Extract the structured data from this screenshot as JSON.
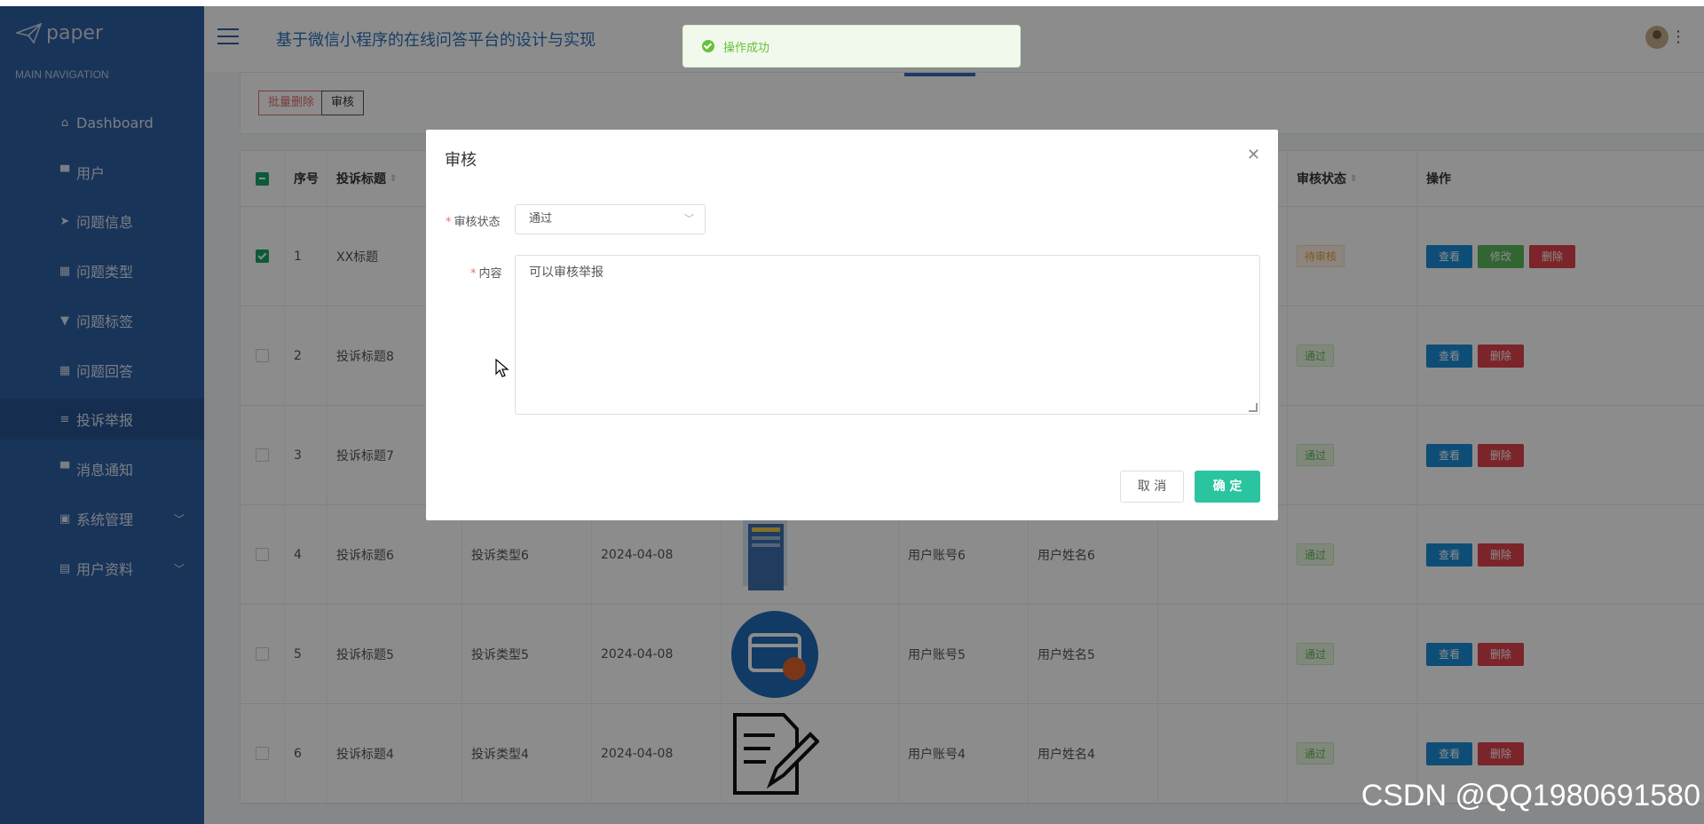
{
  "app": {
    "logo_text": "paper",
    "system_title": "基于微信小程序的在线问答平台的设计与实现"
  },
  "sidebar": {
    "heading": "MAIN NAVIGATION",
    "items": [
      {
        "label": "Dashboard",
        "icon": "home-icon"
      },
      {
        "label": "用户",
        "icon": "comment-icon"
      },
      {
        "label": "问题信息",
        "icon": "send-icon"
      },
      {
        "label": "问题类型",
        "icon": "grid-icon"
      },
      {
        "label": "问题标签",
        "icon": "tag-icon"
      },
      {
        "label": "问题回答",
        "icon": "grid-icon"
      },
      {
        "label": "投诉举报",
        "icon": "list-icon",
        "active": true
      },
      {
        "label": "消息通知",
        "icon": "comment-icon"
      },
      {
        "label": "系统管理",
        "icon": "lock-icon",
        "expandable": true
      },
      {
        "label": "用户资料",
        "icon": "calendar-icon",
        "expandable": true
      }
    ]
  },
  "toolbar": {
    "batch_delete_label": "批量删除",
    "audit_label": "审核"
  },
  "table": {
    "columns": [
      "序号",
      "投诉标题",
      "审核状态",
      "操作"
    ],
    "rows": [
      {
        "index": "1",
        "title": "XX标题",
        "type": "",
        "date": "",
        "account": "",
        "name": "",
        "status": "待审核",
        "checked": true,
        "actions": [
          "查看",
          "修改",
          "删除"
        ]
      },
      {
        "index": "2",
        "title": "投诉标题8",
        "type": "",
        "date": "",
        "account": "",
        "name": "",
        "status": "通过",
        "checked": false,
        "actions": [
          "查看",
          "删除"
        ]
      },
      {
        "index": "3",
        "title": "投诉标题7",
        "type": "",
        "date": "",
        "account": "",
        "name": "",
        "status": "通过",
        "checked": false,
        "actions": [
          "查看",
          "删除"
        ]
      },
      {
        "index": "4",
        "title": "投诉标题6",
        "type": "投诉类型6",
        "date": "2024-04-08",
        "account": "用户账号6",
        "name": "用户姓名6",
        "status": "通过",
        "checked": false,
        "actions": [
          "查看",
          "删除"
        ]
      },
      {
        "index": "5",
        "title": "投诉标题5",
        "type": "投诉类型5",
        "date": "2024-04-08",
        "account": "用户账号5",
        "name": "用户姓名5",
        "status": "通过",
        "checked": false,
        "actions": [
          "查看",
          "删除"
        ]
      },
      {
        "index": "6",
        "title": "投诉标题4",
        "type": "投诉类型4",
        "date": "2024-04-08",
        "account": "用户账号4",
        "name": "用户姓名4",
        "status": "通过",
        "checked": false,
        "actions": [
          "查看",
          "删除"
        ]
      }
    ]
  },
  "modal": {
    "title": "审核",
    "status_label": "审核状态",
    "status_value": "通过",
    "content_label": "内容",
    "content_value": "可以审核举报",
    "cancel_label": "取 消",
    "confirm_label": "确 定"
  },
  "toast": {
    "message": "操作成功"
  },
  "watermark": "CSDN @QQ1980691580",
  "colors": {
    "sidebar": "#2e5fa3",
    "primary": "#1a8fd8",
    "success": "#67c23a",
    "danger": "#e0424e",
    "confirm": "#2bc4a0"
  }
}
